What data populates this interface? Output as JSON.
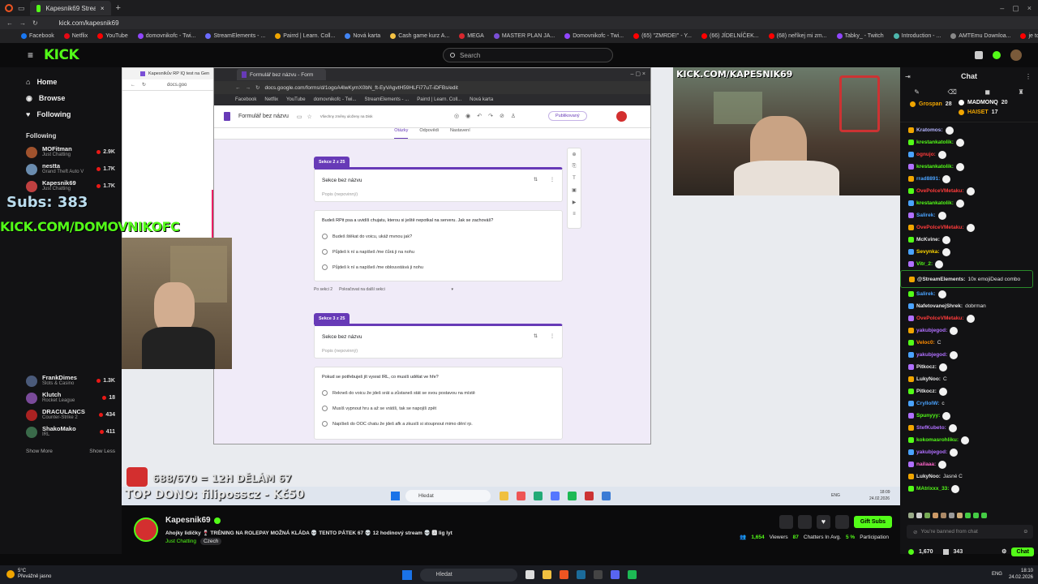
{
  "browser": {
    "tab_title": "Kapesnik69 Stream - Watc",
    "url": "kick.com/kapesnik69",
    "bookmarks": [
      "Facebook",
      "Netflix",
      "YouTube",
      "domovnikofc - Twi...",
      "StreamElements - ...",
      "Pairrd | Learn. Coll...",
      "Nová karta",
      "Cash game kurz A...",
      "MEGA",
      "MASTER PLAN JA...",
      "Domovnikofc - Twi...",
      "(65) \"ZMRDE!\" - Y...",
      "(66) JÍDELNÍČEK...",
      "(68) neříkej mi zm...",
      "Tabky_ - Twitch",
      "Introduction - ...",
      "AMTEmu Downloa...",
      "je to moje první vi..."
    ],
    "bookmark_colors": [
      "#1877f2",
      "#e50914",
      "#ff0000",
      "#9146ff",
      "#6b6bff",
      "#f0a500",
      "#4285f4",
      "#f6c344",
      "#d9272e",
      "#7a4fd6",
      "#9146ff",
      "#ff0000",
      "#ff0000",
      "#ff0000",
      "#9146ff",
      "#4db6ac",
      "#888888",
      "#ff0000"
    ]
  },
  "kick": {
    "logo": "KICK",
    "search_placeholder": "Search",
    "nav": [
      {
        "label": "Home",
        "icon": "home-icon",
        "glyph": "⌂"
      },
      {
        "label": "Browse",
        "icon": "browse-icon",
        "glyph": "◉"
      },
      {
        "label": "Following",
        "icon": "heart-icon",
        "glyph": "♥"
      }
    ],
    "following_header": "Following",
    "show_more": "Show More",
    "show_less": "Show Less",
    "following_top": [
      {
        "name": "MOFitman",
        "game": "Just Chatting",
        "viewers": "2.9K",
        "color": "#a0522d"
      },
      {
        "name": "nestta",
        "game": "Grand Theft Auto V",
        "viewers": "1.7K",
        "color": "#6a8caf"
      },
      {
        "name": "Kapesnik69",
        "game": "Just Chatting",
        "viewers": "1.7K",
        "color": "#c04040"
      }
    ],
    "following_bottom": [
      {
        "name": "FrankDimes",
        "game": "Slots & Casino",
        "viewers": "1.3K",
        "color": "#4a5a7a"
      },
      {
        "name": "Klutch",
        "game": "Rocket League",
        "viewers": "18",
        "color": "#7a4a9a"
      },
      {
        "name": "DRACULANCS",
        "game": "Counter-Strike 2",
        "viewers": "434",
        "color": "#aa2222"
      },
      {
        "name": "ShakoMako",
        "game": "IRL",
        "viewers": "411",
        "color": "#3a6a4a"
      }
    ]
  },
  "overlays": {
    "subs": "Subs: 383",
    "domovnik_link": "KICK.COM/DOMOVNIKOFC",
    "kapesnik_link": "KICK.COM/KAPESNIK69",
    "goal": "688/670 = 12H DĚLÁM 67",
    "top_dono": "TOP DONO: filiposscz - Kč50"
  },
  "forms_window": {
    "tab_title": "Formulář bez názvu - Form",
    "url": "docs.google.com/forms/d/1ogoA4lwKymX0bN_ft-EyVAgvtH59HLFi77uT-iDFBs/edit",
    "bookmarks": [
      "Facebook",
      "Netflix",
      "YouTube",
      "domovnikofc - Twi...",
      "StreamElements - ...",
      "Pairrd | Learn. Coll...",
      "Nová karta"
    ],
    "form_title": "Formulář bez názvu",
    "saved_note": "Všechny změny uloženy na Disk",
    "publish_label": "Publikovaný",
    "tabs": [
      "Otázky",
      "Odpovědi",
      "Nastavení"
    ],
    "sections": [
      {
        "tag": "Sekce 2 z 25",
        "title": "Sekce bez názvu",
        "desc": "Popis (nepovinný)",
        "question": "Budeš RPit psa a uvidíš chujatu, kterou si ještě nepotkal na serveru. Jak se zachováš?",
        "options": [
          "Budeš štěkat do voicu, ukáž mvnou jak?",
          "Půjdeš k ní a napíšeš /me čůrá ji na nohu",
          "Půjdeš k ní a napíšeš /me oblouvstává ji nohu"
        ],
        "after": "Po sekci 2",
        "after_value": "Pokračovat na další sekci"
      },
      {
        "tag": "Sekce 3 z 25",
        "title": "Sekce bez názvu",
        "desc": "Popis (nepovinný)",
        "question": "Pokud se potřebuješ jít vysrat IRL, co musíš udělat ve hře?",
        "options": [
          "Rekneš do voicu že jdeš srát a zůstaneš stát se svou postavou na místě",
          "Musíš vypnout hru a až se vrátíš, tak se napojíš zpět",
          "Napíšeš do OOC chatu že jdeš afk a zkusíš si stoupnout mimo dění rp."
        ]
      }
    ]
  },
  "small_window": {
    "tab_title": "Kapesníkův RP IQ test na Gen",
    "url": "docs.goo"
  },
  "desktop_taskbar": {
    "search": "Hledat",
    "lang": "ENG",
    "time": "18:09",
    "date": "24.02.2026"
  },
  "chat": {
    "title": "Chat",
    "pinned": [
      {
        "user": "Grospan",
        "count": "28",
        "color": "#f0a500"
      },
      {
        "user": "MADMONQ",
        "count": "20",
        "color": "#ffffff"
      },
      {
        "user": "HAISET",
        "count": "17",
        "color": "#f0a500"
      }
    ],
    "messages": [
      {
        "user": "Kratomos:",
        "color": "#b4b4ff",
        "text": ""
      },
      {
        "user": "krestankatolik:",
        "color": "#53fc18",
        "text": ""
      },
      {
        "user": "ognujo:",
        "color": "#ff3b3b",
        "text": ""
      },
      {
        "user": "krestankatolik:",
        "color": "#53fc18",
        "text": ""
      },
      {
        "user": "rrad8891:",
        "color": "#4aa3ff",
        "text": ""
      },
      {
        "user": "OvePolceVMetaku:",
        "color": "#ff3b3b",
        "text": ""
      },
      {
        "user": "krestankatolik:",
        "color": "#53fc18",
        "text": ""
      },
      {
        "user": "Salirek:",
        "color": "#4aa3ff",
        "text": ""
      },
      {
        "user": "OvePolceVMetaku:",
        "color": "#ff3b3b",
        "text": ""
      },
      {
        "user": "McKvine:",
        "color": "#e8e8e8",
        "text": ""
      },
      {
        "user": "Sevynka:",
        "color": "#ffd700",
        "text": ""
      },
      {
        "user": "Vitr_2:",
        "color": "#53fc18",
        "text": ""
      },
      {
        "user": "@StreamElements:",
        "color": "#e8e8e8",
        "text": "10x emojiDead combo"
      },
      {
        "user": "Salirek:",
        "color": "#4aa3ff",
        "text": ""
      },
      {
        "user": "NafetovanejShrek:",
        "color": "#e8e8e8",
        "text": "dobrman"
      },
      {
        "user": "OvePolceVMetaku:",
        "color": "#ff3b3b",
        "text": ""
      },
      {
        "user": "yakubjegod:",
        "color": "#b070ff",
        "text": ""
      },
      {
        "user": "Veloc0:",
        "color": "#ff8c00",
        "text": "C"
      },
      {
        "user": "yakubjegod:",
        "color": "#b070ff",
        "text": ""
      },
      {
        "user": "Pitkocz:",
        "color": "#e8e8e8",
        "text": ""
      },
      {
        "user": "LukyNoo:",
        "color": "#e8e8e8",
        "text": "C"
      },
      {
        "user": "Pitkocz:",
        "color": "#e8e8e8",
        "text": ""
      },
      {
        "user": "CryllolW:",
        "color": "#4aa3ff",
        "text": "c"
      },
      {
        "user": "Spunyyy:",
        "color": "#53fc18",
        "text": ""
      },
      {
        "user": "StefKubeto:",
        "color": "#b070ff",
        "text": ""
      },
      {
        "user": "kokomasrohliku:",
        "color": "#53fc18",
        "text": ""
      },
      {
        "user": "yakubjegod:",
        "color": "#b070ff",
        "text": ""
      },
      {
        "user": "nailaaa:",
        "color": "#ff66cc",
        "text": ""
      },
      {
        "user": "LukyNoo:",
        "color": "#e8e8e8",
        "text": "Jasné C"
      },
      {
        "user": "MAtrixxx_33:",
        "color": "#53fc18",
        "text": ""
      }
    ],
    "banned_text": "You're banned from chat",
    "points": "1,670",
    "subs_count": "343",
    "chat_button": "Chat"
  },
  "stream_info": {
    "channel": "Kapesnik69",
    "title": "Ahojky lidičky 🍷 TRÉNING NA ROLEPAY MOŽNÁ KLÁDA 💀 TENTO PÁTEK 67 💀 12 hodinový stream 💀 🅰 lig lyt",
    "category": "Just Chatting",
    "language": "Czech",
    "viewers": "1,654",
    "viewers_label": "Viewers",
    "chatters": "87",
    "chatters_label": "Chatters In Avg.",
    "participation": "5 %",
    "participation_label": "Participation",
    "gift_subs": "Gift Subs"
  },
  "os_taskbar": {
    "weather_temp": "5°C",
    "weather_text": "Převážně jasno",
    "search": "Hledat",
    "lang": "ENG",
    "time": "18:10",
    "date": "24.02.2026"
  }
}
